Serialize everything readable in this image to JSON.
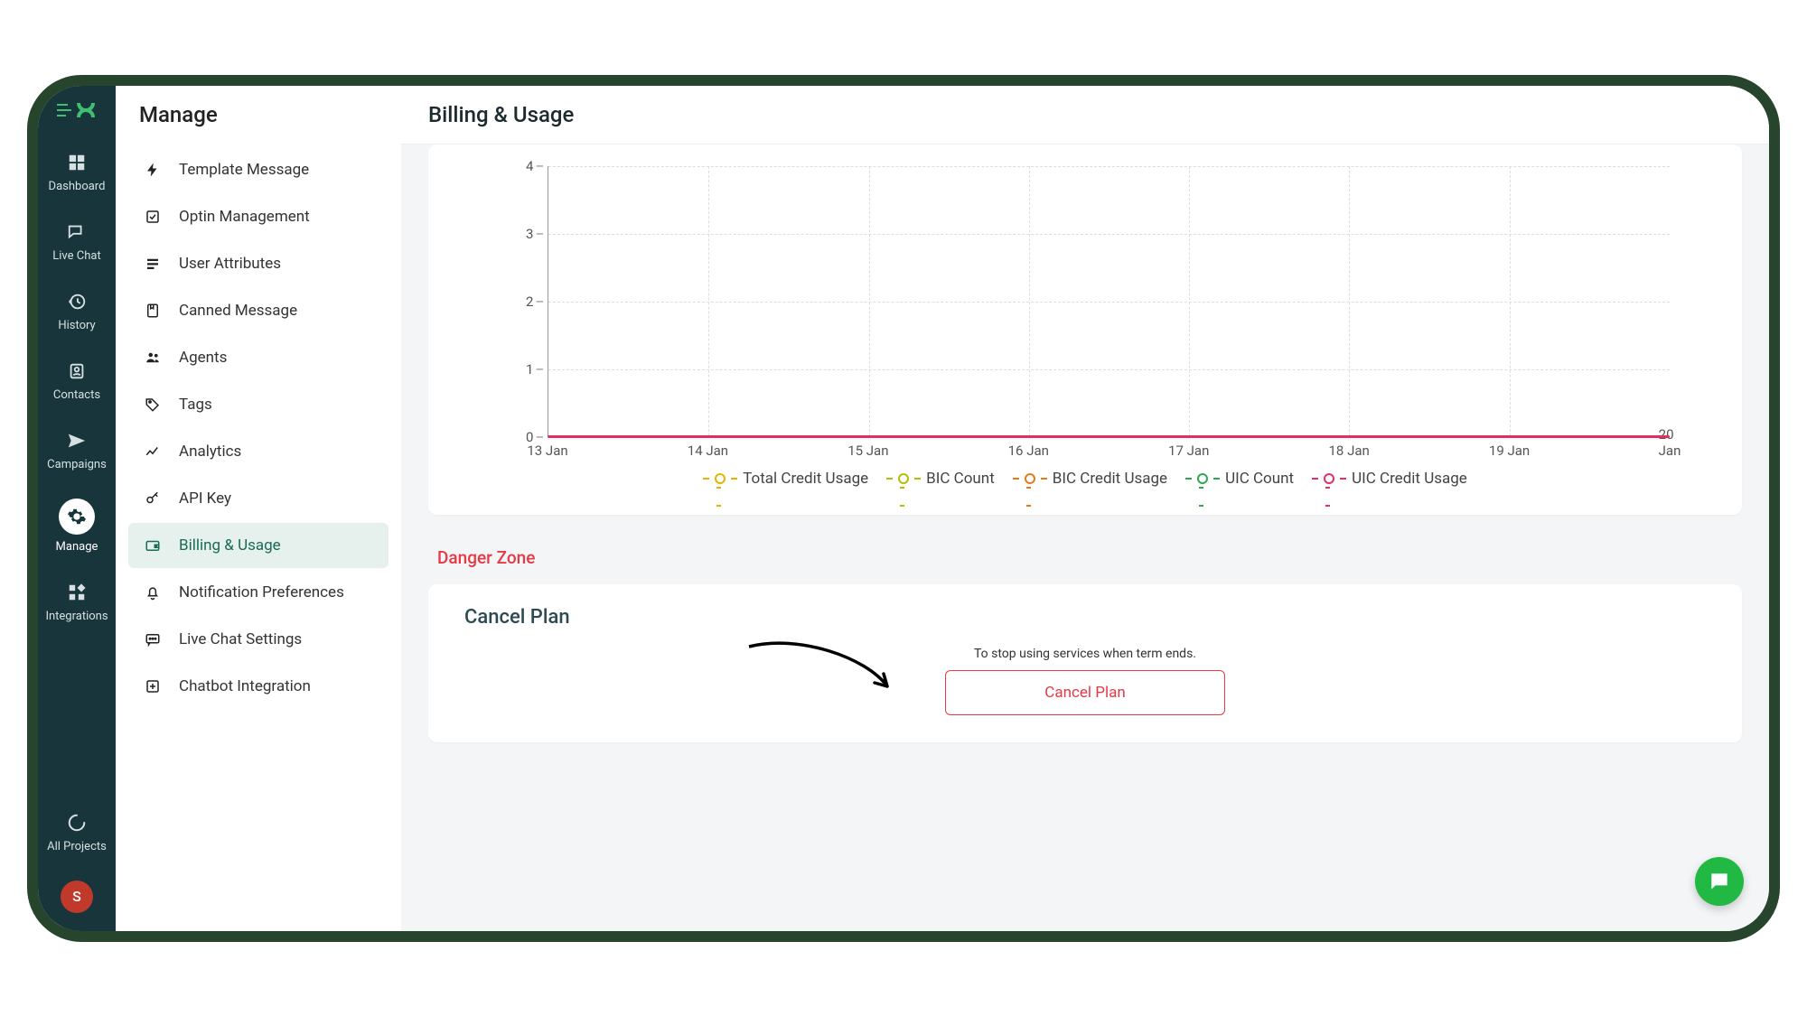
{
  "leftnav": {
    "items": [
      {
        "label": "Dashboard",
        "icon": "dashboard"
      },
      {
        "label": "Live Chat",
        "icon": "chat"
      },
      {
        "label": "History",
        "icon": "history"
      },
      {
        "label": "Contacts",
        "icon": "contacts"
      },
      {
        "label": "Campaigns",
        "icon": "send"
      },
      {
        "label": "Manage",
        "icon": "gear",
        "active": true
      },
      {
        "label": "Integrations",
        "icon": "widgets"
      }
    ],
    "all_projects": {
      "label": "All Projects",
      "icon": "spinner"
    },
    "avatar_initial": "S"
  },
  "sidepanel": {
    "title": "Manage",
    "items": [
      {
        "label": "Template Message",
        "icon": "bolt"
      },
      {
        "label": "Optin Management",
        "icon": "checkbox"
      },
      {
        "label": "User Attributes",
        "icon": "bars"
      },
      {
        "label": "Canned Message",
        "icon": "bookmark"
      },
      {
        "label": "Agents",
        "icon": "people"
      },
      {
        "label": "Tags",
        "icon": "tag"
      },
      {
        "label": "Analytics",
        "icon": "analytics"
      },
      {
        "label": "API Key",
        "icon": "key"
      },
      {
        "label": "Billing & Usage",
        "icon": "wallet",
        "active": true
      },
      {
        "label": "Notification Preferences",
        "icon": "bell"
      },
      {
        "label": "Live Chat Settings",
        "icon": "message"
      },
      {
        "label": "Chatbot Integration",
        "icon": "plus-box"
      }
    ]
  },
  "header": {
    "title": "Billing & Usage"
  },
  "chart_data": {
    "type": "line",
    "categories": [
      "13 Jan",
      "14 Jan",
      "15 Jan",
      "16 Jan",
      "17 Jan",
      "18 Jan",
      "19 Jan",
      "20 Jan"
    ],
    "series": [
      {
        "name": "Total Credit Usage",
        "color": "#e0b600",
        "values": [
          0,
          0,
          0,
          0,
          0,
          0,
          0,
          0
        ]
      },
      {
        "name": "BIC Count",
        "color": "#b0c000",
        "values": [
          0,
          0,
          0,
          0,
          0,
          0,
          0,
          0
        ]
      },
      {
        "name": "BIC Credit Usage",
        "color": "#e57a1a",
        "values": [
          0,
          0,
          0,
          0,
          0,
          0,
          0,
          0
        ]
      },
      {
        "name": "UIC Count",
        "color": "#2fa84f",
        "values": [
          0,
          0,
          0,
          0,
          0,
          0,
          0,
          0
        ]
      },
      {
        "name": "UIC Credit Usage",
        "color": "#e5305e",
        "values": [
          0,
          0,
          0,
          0,
          0,
          0,
          0,
          0
        ]
      }
    ],
    "yticks": [
      0,
      1,
      2,
      3,
      4
    ],
    "ylim": [
      0,
      4
    ],
    "xlabel": "",
    "ylabel": ""
  },
  "danger": {
    "title": "Danger Zone",
    "card_title": "Cancel Plan",
    "description": "To stop using services when term ends.",
    "button_label": "Cancel Plan"
  }
}
